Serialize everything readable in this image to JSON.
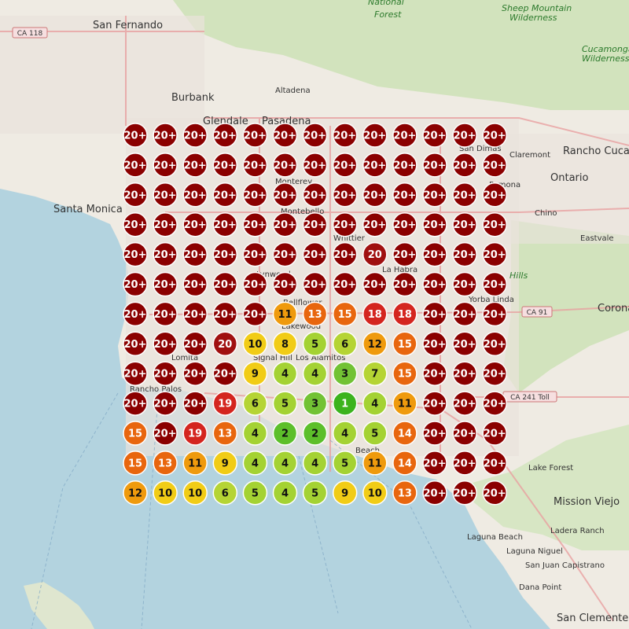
{
  "map": {
    "places_major": [
      {
        "name": "San Fernando"
      },
      {
        "name": "Burbank"
      },
      {
        "name": "Glendale"
      },
      {
        "name": "Pasadena"
      },
      {
        "name": "Altadena"
      },
      {
        "name": "Santa Monica"
      },
      {
        "name": "Ontario"
      },
      {
        "name": "Pomona"
      },
      {
        "name": "Rancho Cucamonga"
      },
      {
        "name": "Chino"
      },
      {
        "name": "Mission Viejo"
      },
      {
        "name": "Lake Forest"
      },
      {
        "name": "San Clemente"
      },
      {
        "name": "Corona"
      }
    ],
    "places_minor": [
      {
        "name": "Monterey"
      },
      {
        "name": "Montebello"
      },
      {
        "name": "Whittier"
      },
      {
        "name": "La Habra"
      },
      {
        "name": "Bellflower"
      },
      {
        "name": "Lakewood"
      },
      {
        "name": "Signal Hill"
      },
      {
        "name": "Los Alamitos"
      },
      {
        "name": "Lomita"
      },
      {
        "name": "Rancho Palos"
      },
      {
        "name": "Claremont"
      },
      {
        "name": "San Dimas"
      },
      {
        "name": "Yorba Linda"
      },
      {
        "name": "Eastvale"
      },
      {
        "name": "Ladera Ranch"
      },
      {
        "name": "Laguna Beach"
      },
      {
        "name": "Laguna Niguel"
      },
      {
        "name": "San Juan Capistrano"
      },
      {
        "name": "Dana Point"
      },
      {
        "name": "Beach"
      },
      {
        "name": "Lynwood"
      },
      {
        "name": "Hills"
      }
    ],
    "forests": [
      {
        "name": "National"
      },
      {
        "name": "Forest"
      },
      {
        "name": "Sheep Mountain"
      },
      {
        "name": "Wilderness"
      },
      {
        "name": "Cucamonga"
      },
      {
        "name": "Wilderness"
      }
    ],
    "shields": [
      {
        "label": "CA 118"
      },
      {
        "label": "CA 91"
      },
      {
        "label": "CA 241 Toll"
      }
    ]
  },
  "grid": {
    "rows": [
      [
        "20+",
        "20+",
        "20+",
        "20+",
        "20+",
        "20+",
        "20+",
        "20+",
        "20+",
        "20+",
        "20+",
        "20+",
        "20+"
      ],
      [
        "20+",
        "20+",
        "20+",
        "20+",
        "20+",
        "20+",
        "20+",
        "20+",
        "20+",
        "20+",
        "20+",
        "20+",
        "20+"
      ],
      [
        "20+",
        "20+",
        "20+",
        "20+",
        "20+",
        "20+",
        "20+",
        "20+",
        "20+",
        "20+",
        "20+",
        "20+",
        "20+"
      ],
      [
        "20+",
        "20+",
        "20+",
        "20+",
        "20+",
        "20+",
        "20+",
        "20+",
        "20+",
        "20+",
        "20+",
        "20+",
        "20+"
      ],
      [
        "20+",
        "20+",
        "20+",
        "20+",
        "20+",
        "20+",
        "20+",
        "20+",
        "20",
        "20+",
        "20+",
        "20+",
        "20+"
      ],
      [
        "20+",
        "20+",
        "20+",
        "20+",
        "20+",
        "20+",
        "20+",
        "20+",
        "20+",
        "20+",
        "20+",
        "20+",
        "20+"
      ],
      [
        "20+",
        "20+",
        "20+",
        "20+",
        "20+",
        "11",
        "13",
        "15",
        "18",
        "18",
        "20+",
        "20+",
        "20+"
      ],
      [
        "20+",
        "20+",
        "20+",
        "20",
        "10",
        "8",
        "5",
        "6",
        "12",
        "15",
        "20+",
        "20+",
        "20+"
      ],
      [
        "20+",
        "20+",
        "20+",
        "20+",
        "9",
        "4",
        "4",
        "3",
        "7",
        "15",
        "20+",
        "20+",
        "20+"
      ],
      [
        "20+",
        "20+",
        "20+",
        "19",
        "6",
        "5",
        "3",
        "1",
        "4",
        "11",
        "20+",
        "20+",
        "20+"
      ],
      [
        "15",
        "20+",
        "19",
        "13",
        "4",
        "2",
        "2",
        "4",
        "5",
        "14",
        "20+",
        "20+",
        "20+"
      ],
      [
        "15",
        "13",
        "11",
        "9",
        "4",
        "4",
        "4",
        "5",
        "11",
        "14",
        "20+",
        "20+",
        "20+"
      ],
      [
        "12",
        "10",
        "10",
        "6",
        "5",
        "4",
        "5",
        "9",
        "10",
        "13",
        "20+",
        "20+",
        "20+"
      ]
    ]
  },
  "colors": {
    "water": "#b3d3df",
    "land": "#f2efe9",
    "park": "#c8dfb0",
    "mountain": "#dde4cf",
    "urban": "#e8e2dc"
  }
}
